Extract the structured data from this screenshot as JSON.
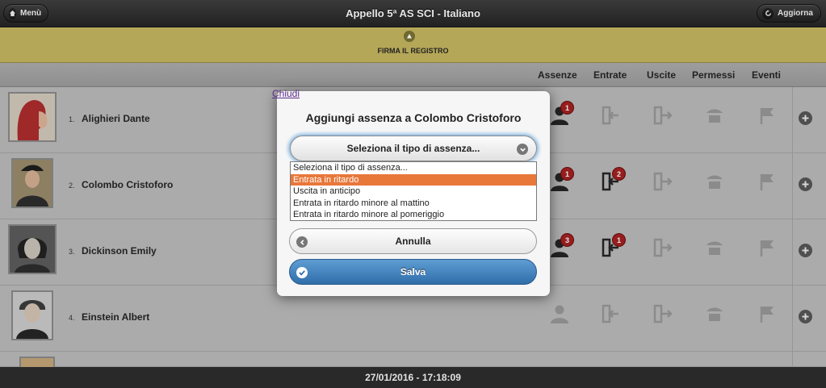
{
  "header": {
    "menu_label": "Menù",
    "title": "Appello 5ª AS SCI - Italiano",
    "refresh_label": "Aggiorna"
  },
  "sign_banner": {
    "label": "FIRMA IL REGISTRO"
  },
  "columns": [
    "Assenze",
    "Entrate",
    "Uscite",
    "Permessi",
    "Eventi"
  ],
  "students": [
    {
      "num": "1.",
      "name": "Alighieri Dante",
      "absences": "1",
      "entries": ""
    },
    {
      "num": "2.",
      "name": "Colombo Cristoforo",
      "absences": "1",
      "entries": "2"
    },
    {
      "num": "3.",
      "name": "Dickinson Emily",
      "absences": "3",
      "entries": "1"
    },
    {
      "num": "4.",
      "name": "Einstein Albert",
      "absences": "",
      "entries": ""
    }
  ],
  "popup": {
    "close_label": "Chiudi",
    "title": "Aggiungi assenza a Colombo Cristoforo",
    "select_label": "Seleziona il tipo di assenza...",
    "options": [
      "Seleziona il tipo di assenza...",
      "Entrata in ritardo",
      "Uscita in anticipo",
      "Entrata in ritardo minore al mattino",
      "Entrata in ritardo minore al pomeriggio"
    ],
    "highlighted_option": "Entrata in ritardo",
    "cancel_label": "Annulla",
    "save_label": "Salva"
  },
  "footer": {
    "datetime": "27/01/2016 - 17:18:09"
  },
  "colors": {
    "accent": "#3f7fbf",
    "banner": "#b5a758",
    "badge": "#a51d1d",
    "highlight": "#e8773a"
  }
}
